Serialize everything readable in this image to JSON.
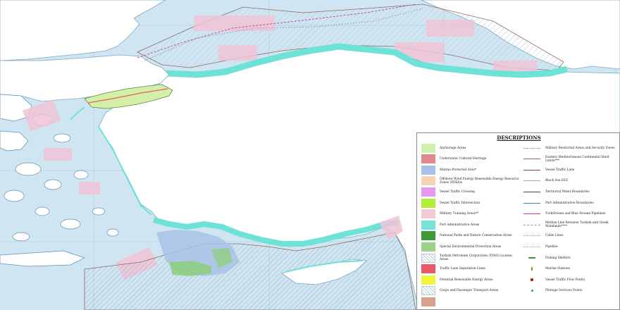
{
  "legend": {
    "title": "DESCRIPTIONS",
    "left_items": [
      {
        "label": "Anchorage Areas",
        "color": "#d4f0a8",
        "pattern": "solid"
      },
      {
        "label": "Underwater Cultural Heritage",
        "color": "#e08a8e",
        "pattern": "solid"
      },
      {
        "label": "Marine Protected Area*",
        "color": "#a9c1e6",
        "pattern": "solid"
      },
      {
        "label": "Offshore Wind Energy Renewable Energy Resource Zones (YEKA)s",
        "color": "#f7d2b4",
        "pattern": "solid"
      },
      {
        "label": "Vessel Traffic Crossing",
        "color": "#e59af0",
        "pattern": "solid"
      },
      {
        "label": "Vessel Traffic Intersection",
        "color": "#b5ec3c",
        "pattern": "solid"
      },
      {
        "label": "Military Training Areas**",
        "color": "#f5cad8",
        "pattern": "solid"
      },
      {
        "label": "Port Administrative Areas",
        "color": "#78e3d8",
        "pattern": "solid"
      },
      {
        "label": "National Parks and Nature Conservation Areas",
        "color": "#3c9a3c",
        "pattern": "solid"
      },
      {
        "label": "Special Environmental Protection Areas",
        "color": "#9cd08a",
        "pattern": "solid"
      },
      {
        "label": "Turkish Petroleum Corporation (TPAO) License Areas",
        "color": "#ffffff",
        "pattern": "hatch"
      },
      {
        "label": "Traffic Lane Separation Lines",
        "color": "#e85a64",
        "pattern": "solid"
      },
      {
        "label": "Potential Renewable Energy Areas",
        "color": "#eef53a",
        "pattern": "solid"
      },
      {
        "label": "Cargo and Passenger Transport Areas",
        "color": "#ffffff",
        "pattern": "hatch-light"
      },
      {
        "label": "",
        "color": "#d9a090",
        "pattern": "solid"
      }
    ],
    "right_items": [
      {
        "label": "Military Restricted Areas and Security Zones",
        "color": "#8a8ac8",
        "style": "dotted"
      },
      {
        "label": "Eastern Mediterranean Continental Shelf Limits***",
        "color": "#8c6a5e",
        "style": "solid-thin"
      },
      {
        "label": "Vessel Traffic Lane",
        "color": "#7a4a4a",
        "style": "solid"
      },
      {
        "label": "Black Sea EEZ",
        "color": "#b8a0a0",
        "style": "solid-thin"
      },
      {
        "label": "Territorial Water Boundaries",
        "color": "#5a3a3a",
        "style": "solid"
      },
      {
        "label": "Port Administrative Boundaries",
        "color": "#4a7ab0",
        "style": "solid-thin"
      },
      {
        "label": "TurkStream and Blue Stream Pipelines",
        "color": "#c03a9a",
        "style": "solid"
      },
      {
        "label": "Median Line Between Turkish and Greek Mainlands****",
        "color": "#9a8acc",
        "style": "dashed"
      },
      {
        "label": "Cable Lines",
        "color": "#9a9a9a",
        "style": "dotted"
      },
      {
        "label": "Pipeline",
        "color": "#a0a0d0",
        "style": "dotted"
      },
      {
        "label": "Fishing Shelters",
        "color": "#3a9a3a",
        "style": "fish"
      },
      {
        "label": "Marine Stations",
        "color": "#7a9a3a",
        "style": "tick"
      },
      {
        "label": "Vessel Traffic Flow Points",
        "color": "#b01010",
        "style": "dot"
      },
      {
        "label": "Pilotage Services Points",
        "color": "#3a8ac0",
        "style": "small-dot"
      }
    ]
  },
  "colors": {
    "sea": "#cfe6f2",
    "land": "#ffffff",
    "coast_buffer": "#6fe2d8",
    "military": "#f0c3d6",
    "grid": "#9fc0d4",
    "boundary": "#8c6a5e"
  }
}
